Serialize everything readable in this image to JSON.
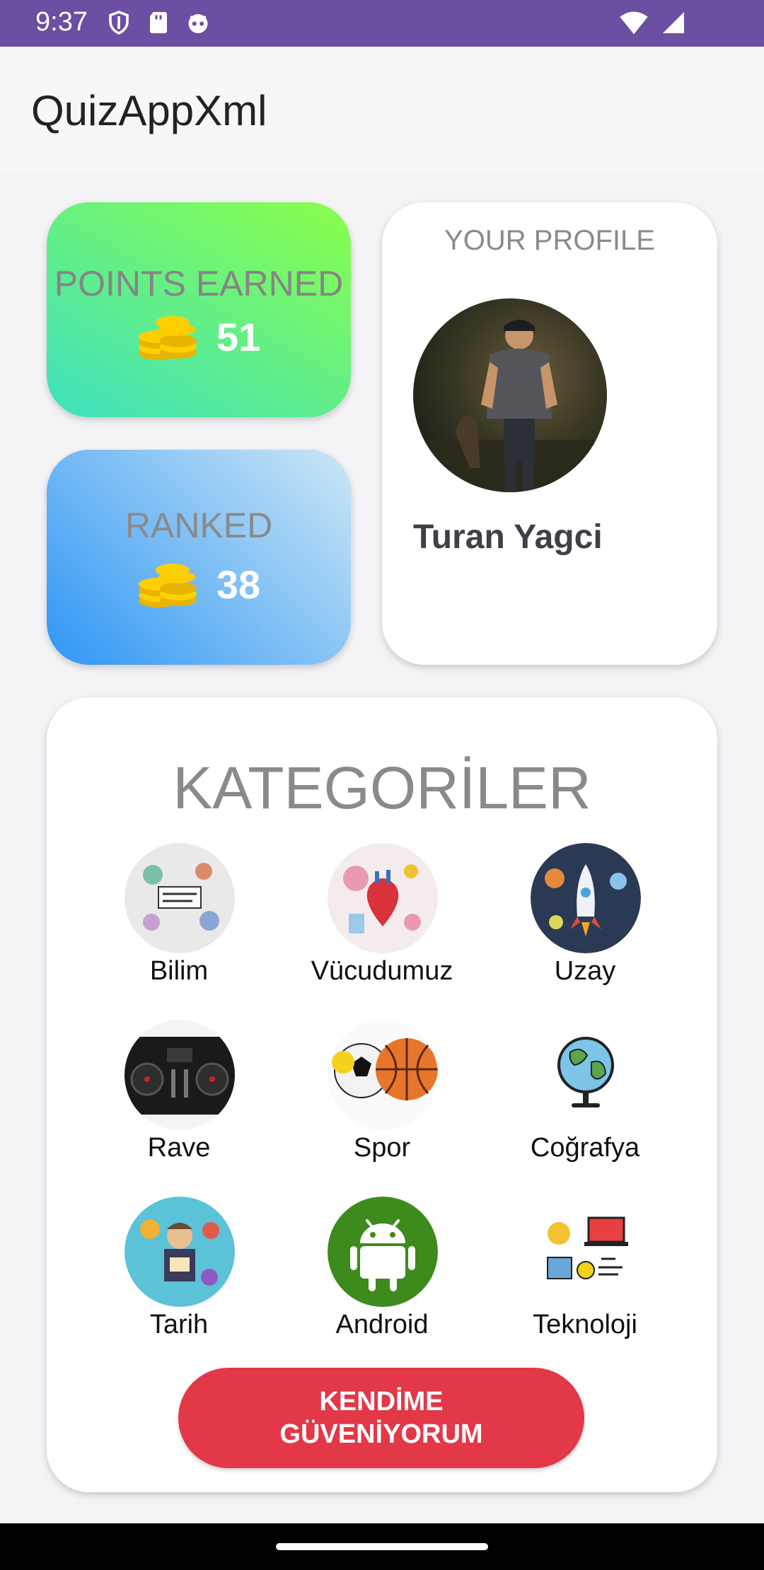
{
  "status_bar": {
    "time": "9:37",
    "icons_left": [
      "shield-icon",
      "sd-card-icon",
      "notification-app-icon"
    ],
    "icons_right": [
      "wifi-icon",
      "cellular-signal-icon"
    ],
    "background": "#6a4fa3"
  },
  "app_bar": {
    "title": "QuizAppXml"
  },
  "points_card": {
    "label": "POINTS EARNED",
    "value": "51",
    "icon": "coins-icon"
  },
  "ranked_card": {
    "label": "RANKED",
    "value": "38",
    "icon": "coins-icon"
  },
  "profile_card": {
    "heading": "YOUR PROFILE",
    "name": "Turan Yagci"
  },
  "categories": {
    "title": "KATEGORİLER",
    "items": [
      {
        "label": "Bilim",
        "image": "science-doodle-image"
      },
      {
        "label": "Vücudumuz",
        "image": "human-body-doodle-image"
      },
      {
        "label": "Uzay",
        "image": "space-rocket-doodle-image"
      },
      {
        "label": "Rave",
        "image": "dj-controller-image"
      },
      {
        "label": "Spor",
        "image": "sports-balls-image"
      },
      {
        "label": "Coğrafya",
        "image": "globe-image"
      },
      {
        "label": "Tarih",
        "image": "history-doodle-image"
      },
      {
        "label": "Android",
        "image": "android-logo-image"
      },
      {
        "label": "Teknoloji",
        "image": "technology-doodle-image"
      }
    ]
  },
  "cta": {
    "line1": "KENDİME",
    "line2": "GÜVENİYORUM",
    "color": "#e33848"
  }
}
